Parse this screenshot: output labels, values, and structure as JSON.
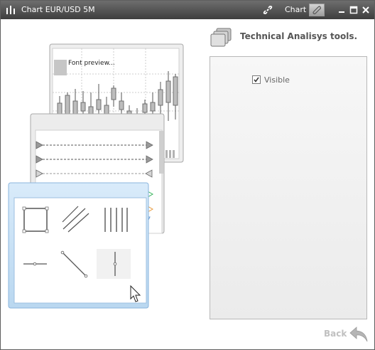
{
  "window": {
    "title": "Chart EUR/USD 5M",
    "chart_label": "Chart"
  },
  "icons": {
    "app": "chart-bars-icon",
    "link": "link-icon",
    "attach": "paperclip-icon",
    "minimize": "minimize-icon",
    "maximize": "maximize-icon",
    "close": "close-icon",
    "tools": "stacked-cards-icon",
    "back": "back-arrow-icon",
    "cursor": "mouse-cursor-icon"
  },
  "panel": {
    "title": "Technical Analisys tools.",
    "visible_label": "Visible",
    "visible_checked": true
  },
  "preview": {
    "font_preview_label": "Font preview..."
  },
  "nav": {
    "back_label": "Back"
  },
  "colors": {
    "titlebar": "#4e4e4e",
    "selected_card_border": "#8ab4dd",
    "guide_green": "#35b35a",
    "guide_orange": "#e89a3c"
  }
}
